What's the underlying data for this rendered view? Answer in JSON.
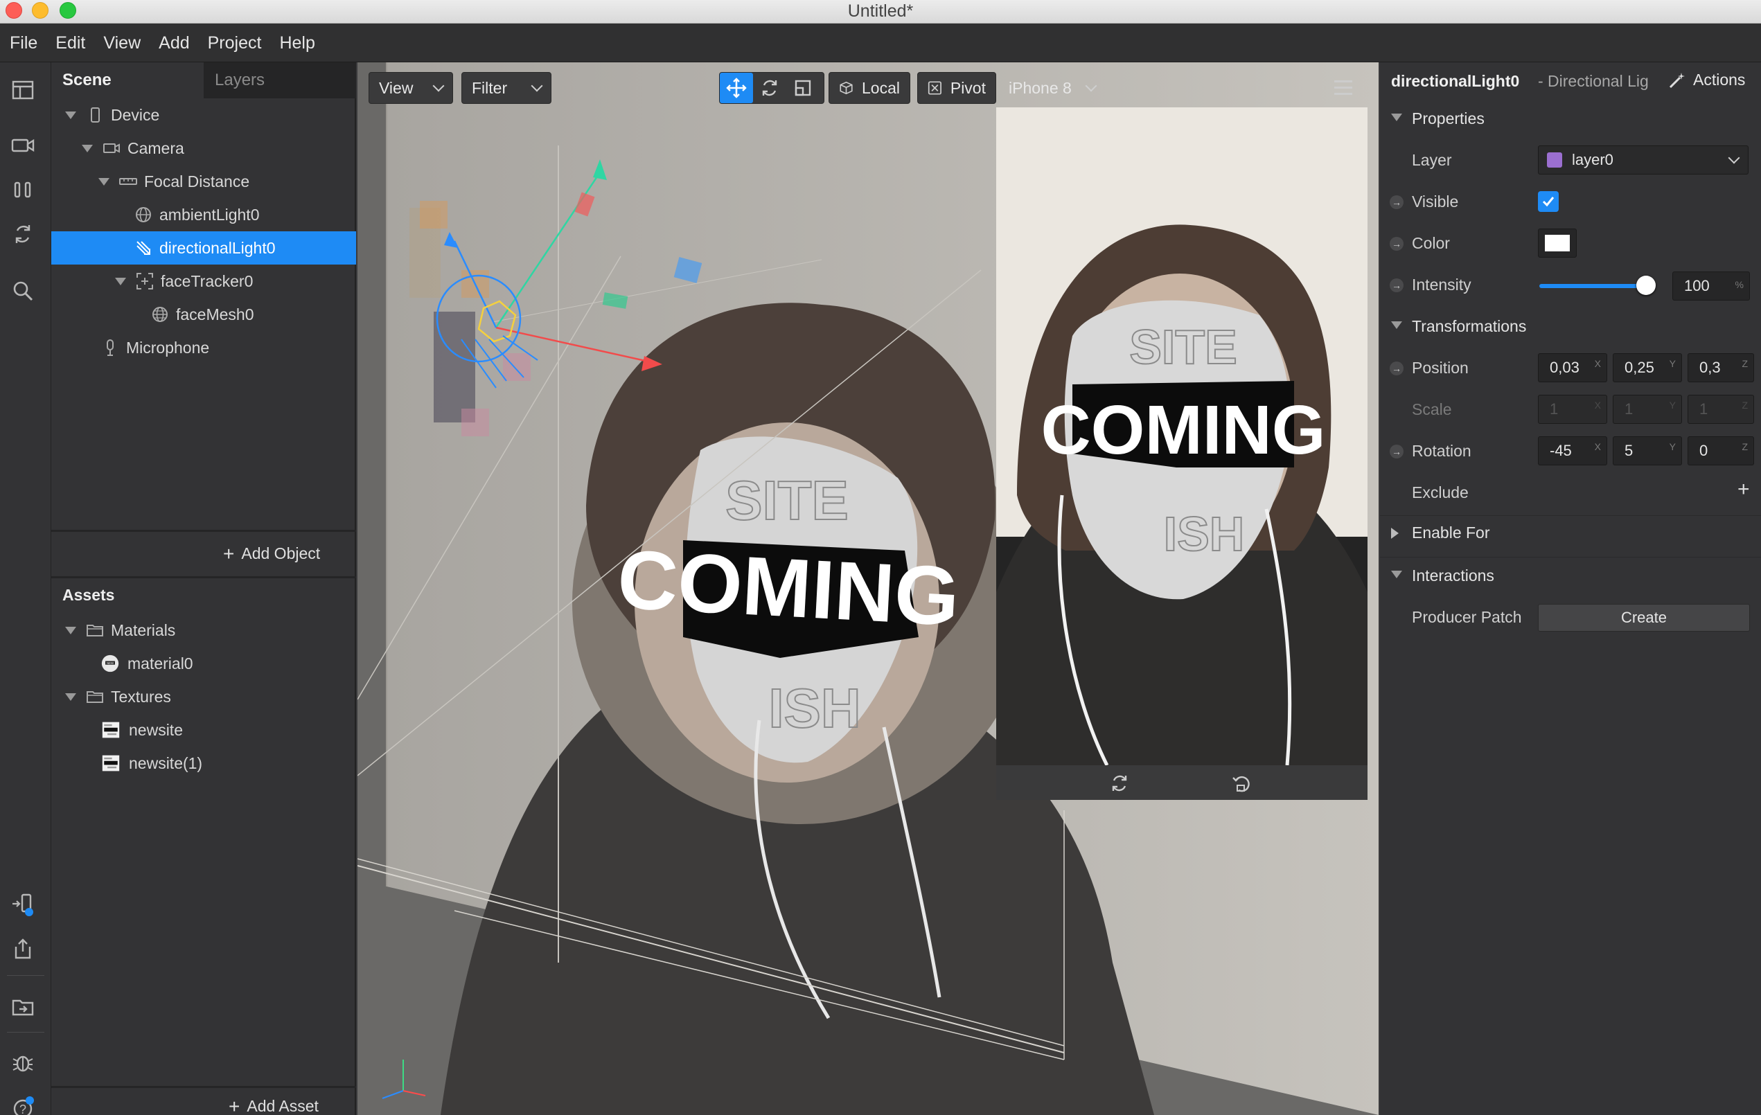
{
  "window": {
    "title": "Untitled*"
  },
  "menu": [
    "File",
    "Edit",
    "View",
    "Add",
    "Project",
    "Help"
  ],
  "scene_panel": {
    "tabs": [
      "Scene",
      "Layers"
    ],
    "tree": [
      {
        "label": "Device",
        "icon": "device-icon"
      },
      {
        "label": "Camera",
        "icon": "camera-icon"
      },
      {
        "label": "Focal Distance",
        "icon": "focal-distance-icon"
      },
      {
        "label": "ambientLight0",
        "icon": "globe-light-icon"
      },
      {
        "label": "directionalLight0",
        "icon": "directional-light-icon",
        "selected": true
      },
      {
        "label": "faceTracker0",
        "icon": "face-tracker-icon"
      },
      {
        "label": "faceMesh0",
        "icon": "mesh-icon"
      },
      {
        "label": "Microphone",
        "icon": "microphone-icon"
      }
    ],
    "add_object": "Add Object",
    "assets_title": "Assets",
    "assets": [
      {
        "label": "Materials",
        "icon": "folder-icon"
      },
      {
        "label": "material0",
        "icon": "material-icon"
      },
      {
        "label": "Textures",
        "icon": "folder-icon"
      },
      {
        "label": "newsite",
        "icon": "texture-icon"
      },
      {
        "label": "newsite(1)",
        "icon": "texture-icon"
      }
    ],
    "add_asset": "Add Asset"
  },
  "viewport": {
    "view_label": "View",
    "filter_label": "Filter",
    "local_label": "Local",
    "pivot_label": "Pivot",
    "device_label": "iPhone 8",
    "mask_top": "SITE",
    "mask_middle": "COMING",
    "mask_bottom": "ISH"
  },
  "properties": {
    "object_name": "directionalLight0",
    "object_type": "- Directional Lig",
    "actions_label": "Actions",
    "section_properties": "Properties",
    "layer_label": "Layer",
    "layer_value": "layer0",
    "visible_label": "Visible",
    "visible": true,
    "color_label": "Color",
    "intensity_label": "Intensity",
    "intensity_value": "100",
    "intensity_unit": "%",
    "section_transformations": "Transformations",
    "position_label": "Position",
    "position": [
      "0,03",
      "0,25",
      "0,3"
    ],
    "scale_label": "Scale",
    "scale": [
      "1",
      "1",
      "1"
    ],
    "rotation_label": "Rotation",
    "rotation": [
      "-45",
      "5",
      "0"
    ],
    "axes": [
      "X",
      "Y",
      "Z"
    ],
    "exclude_label": "Exclude",
    "enable_for_label": "Enable For",
    "section_interactions": "Interactions",
    "producer_patch_label": "Producer Patch",
    "create_label": "Create"
  },
  "colors": {
    "selection": "#1e8bf5",
    "layer_swatch": "#9b6fd0",
    "color_swatch": "#ffffff"
  }
}
